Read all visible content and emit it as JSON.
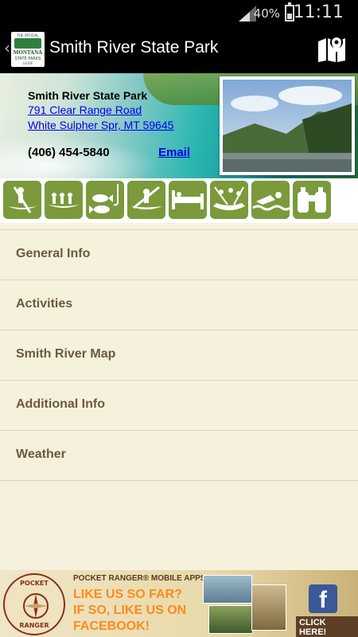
{
  "status_bar": {
    "battery_pct": "40%",
    "time": "11:11"
  },
  "action_bar": {
    "back_glyph": "‹",
    "logo": {
      "small_top": "THE OFFICIAL",
      "name": "MONTANA",
      "sub": "STATE PARKS",
      "tag": "GUIDE"
    },
    "title": "Smith River State Park",
    "map_icon": "map-pin-icon"
  },
  "park": {
    "name": "Smith River State Park",
    "address_line1": "791 Clear Range Road",
    "address_line2": "White Sulpher Spr, MT 59645",
    "phone": "(406) 454-5840",
    "email_label": "Email"
  },
  "activities": [
    {
      "icon": "canoe-icon"
    },
    {
      "icon": "rowing-team-icon"
    },
    {
      "icon": "fishing-icon"
    },
    {
      "icon": "kayak-icon"
    },
    {
      "icon": "lodging-icon"
    },
    {
      "icon": "rafting-icon"
    },
    {
      "icon": "swimming-icon"
    },
    {
      "icon": "binoculars-icon"
    }
  ],
  "menu": [
    {
      "label": "General Info"
    },
    {
      "label": "Activities"
    },
    {
      "label": "Smith River Map"
    },
    {
      "label": "Additional Info"
    },
    {
      "label": "Weather"
    }
  ],
  "ad": {
    "badge_top": "POCKET",
    "badge_bottom": "RANGER",
    "line1": "POCKET RANGER® MOBILE APPS",
    "line2": "LIKE US SO FAR?",
    "line3": "IF SO, LIKE US ON",
    "line4": "FACEBOOK!",
    "fb_glyph": "f",
    "cta": "CLICK HERE!"
  },
  "colors": {
    "menu_text": "#6b5a40",
    "background": "#f5f1dc",
    "activity_green": "#7a9a3c"
  }
}
